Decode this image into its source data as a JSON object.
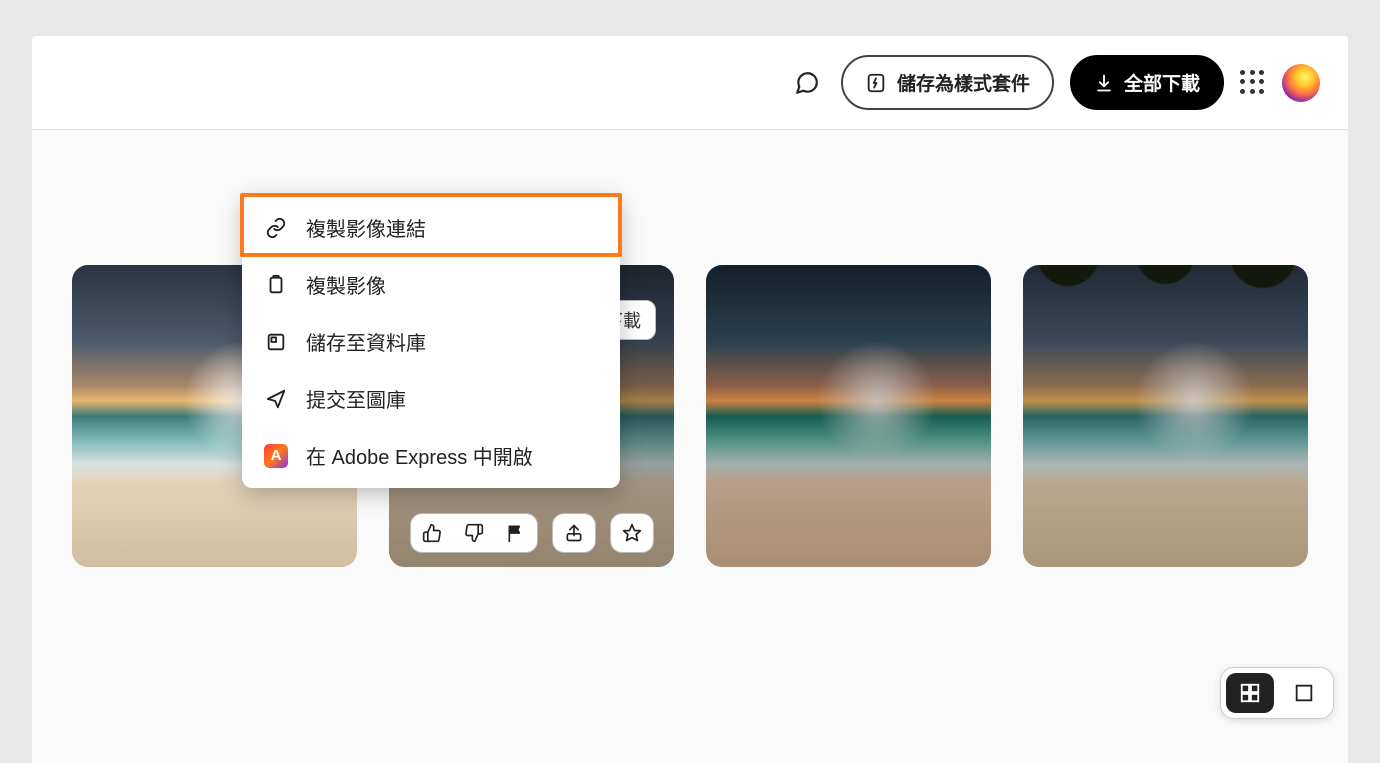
{
  "topbar": {
    "save_style_label": "儲存為樣式套件",
    "download_all_label": "全部下載"
  },
  "thumbs": {
    "partial_tag": "下載"
  },
  "context_menu": {
    "items": [
      {
        "id": "copy-link",
        "label": "複製影像連結"
      },
      {
        "id": "copy-image",
        "label": "複製影像"
      },
      {
        "id": "save-library",
        "label": "儲存至資料庫"
      },
      {
        "id": "submit-stock",
        "label": "提交至圖庫"
      },
      {
        "id": "open-express",
        "label": "在 Adobe Express 中開啟"
      }
    ],
    "adobe_logo_letter": "A"
  }
}
